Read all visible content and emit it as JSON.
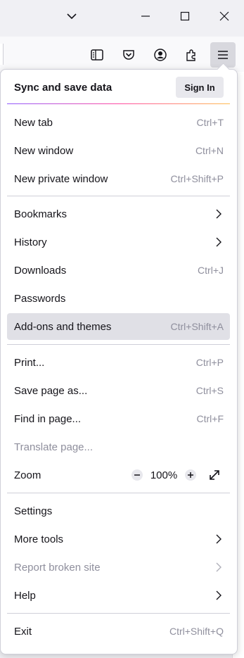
{
  "menu": {
    "sync": {
      "label": "Sync and save data",
      "sign_in": "Sign In"
    },
    "items": {
      "new_tab": {
        "label": "New tab",
        "shortcut": "Ctrl+T"
      },
      "new_window": {
        "label": "New window",
        "shortcut": "Ctrl+N"
      },
      "new_private_window": {
        "label": "New private window",
        "shortcut": "Ctrl+Shift+P"
      },
      "bookmarks": {
        "label": "Bookmarks"
      },
      "history": {
        "label": "History"
      },
      "downloads": {
        "label": "Downloads",
        "shortcut": "Ctrl+J"
      },
      "passwords": {
        "label": "Passwords"
      },
      "addons": {
        "label": "Add-ons and themes",
        "shortcut": "Ctrl+Shift+A"
      },
      "print": {
        "label": "Print...",
        "shortcut": "Ctrl+P"
      },
      "save_page": {
        "label": "Save page as...",
        "shortcut": "Ctrl+S"
      },
      "find": {
        "label": "Find in page...",
        "shortcut": "Ctrl+F"
      },
      "translate": {
        "label": "Translate page..."
      },
      "zoom": {
        "label": "Zoom",
        "value": "100%"
      },
      "settings": {
        "label": "Settings"
      },
      "more_tools": {
        "label": "More tools"
      },
      "report": {
        "label": "Report broken site"
      },
      "help": {
        "label": "Help"
      },
      "exit": {
        "label": "Exit",
        "shortcut": "Ctrl+Shift+Q"
      }
    }
  },
  "toolbar": {
    "icons": [
      "sidebar-icon",
      "pocket-icon",
      "account-icon",
      "extensions-icon",
      "hamburger-menu-icon"
    ]
  },
  "window": {
    "icons": [
      "tab-list-chevron-icon",
      "minimize-icon",
      "maximize-icon",
      "close-icon"
    ]
  },
  "colors": {
    "accent_gradient": [
      "#9059ff",
      "#ff4aa2",
      "#ffbd4f"
    ],
    "hover": "#e0e0e6",
    "muted": "#8f8f9d"
  }
}
